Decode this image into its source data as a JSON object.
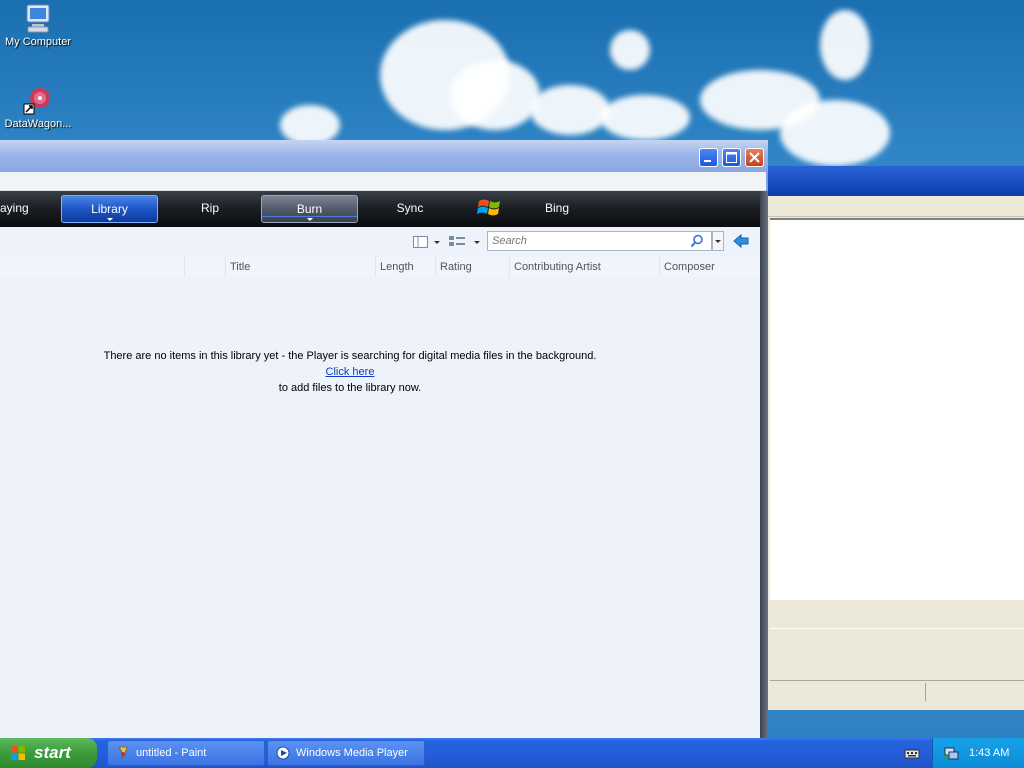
{
  "desktop": {
    "icons": [
      {
        "label": "My Computer",
        "icon": "computer-icon"
      },
      {
        "label": "DataWagon...",
        "icon": "datawagon-shortcut-icon"
      }
    ]
  },
  "wmp": {
    "window_controls": {
      "minimize": "minimize-icon",
      "maximize": "maximize-icon",
      "close": "close-icon"
    },
    "nav_tabs": [
      {
        "label": "aying"
      },
      {
        "label": "Library"
      },
      {
        "label": "Rip"
      },
      {
        "label": "Burn"
      },
      {
        "label": "Sync"
      },
      {
        "label": "Bing"
      }
    ],
    "search": {
      "placeholder": "Search"
    },
    "columns": [
      "Title",
      "Length",
      "Rating",
      "Contributing Artist",
      "Composer"
    ],
    "empty_message": {
      "line1": "There are no items in this library yet - the Player is searching for digital media files in the background.",
      "link": "Click here",
      "line3": "to add files to the library now."
    }
  },
  "taskbar": {
    "start_label": "start",
    "tasks": [
      {
        "label": "untitled - Paint",
        "icon": "paint-icon"
      },
      {
        "label": "Windows Media Player",
        "icon": "media-player-icon"
      }
    ],
    "clock": "1:43 AM"
  },
  "colors": {
    "accent": "#245edb",
    "nav_selected": "#1d55c6",
    "link": "#0a3cc8"
  }
}
